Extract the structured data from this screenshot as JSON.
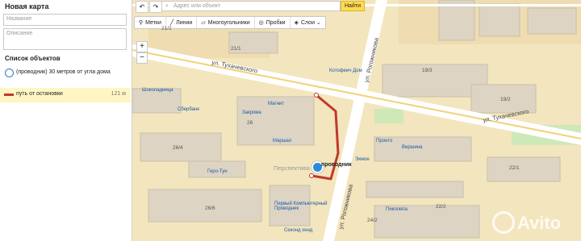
{
  "sidebar": {
    "title": "Новая карта",
    "name_placeholder": "Название",
    "description_placeholder": "Описание",
    "list_title": "Список объектов",
    "objects": [
      {
        "label": "(проводник) 30 метров от угла дома",
        "type": "circle",
        "color": "#3b74c8"
      },
      {
        "label": "путь от остановки",
        "type": "path",
        "length": "121 м",
        "color": "#c0392b"
      }
    ]
  },
  "toolbar": {
    "undo_icon": "undo-icon",
    "redo_icon": "redo-icon",
    "search_placeholder": "Адрес или объект",
    "find_label": "Найти",
    "tools": [
      {
        "label": "Метки",
        "icon": "pin-icon"
      },
      {
        "label": "Линии",
        "icon": "line-icon"
      },
      {
        "label": "Многоугольники",
        "icon": "polygon-icon"
      },
      {
        "label": "Пробки",
        "icon": "traffic-icon"
      },
      {
        "label": "Слои",
        "icon": "layers-icon"
      }
    ],
    "zoom_in": "+",
    "zoom_out": "−"
  },
  "map": {
    "streets": [
      "ул. Тухачевского",
      "ул. Тухачевского",
      "ул. Рогожникова",
      "ул. Рогожникова"
    ],
    "buildings": [
      "21/1",
      "21/2",
      "19/3",
      "19/2",
      "26",
      "26/4",
      "26/6",
      "22/1",
      "24/2",
      "22/2"
    ],
    "pois": [
      "Шоколадница",
      "Сбербанк",
      "Магнит",
      "Закрома",
      "Маршал",
      "Котофеич Дом",
      "Пронто",
      "Вершина",
      "Гиро-Тун",
      "Экмон",
      "Первый Компьютерный Проводник",
      "Пикопепа",
      "Секонд хенд",
      "Перспектива"
    ],
    "marker_label": "проводник",
    "route_color": "#c0392b",
    "watermark": "Avito"
  }
}
